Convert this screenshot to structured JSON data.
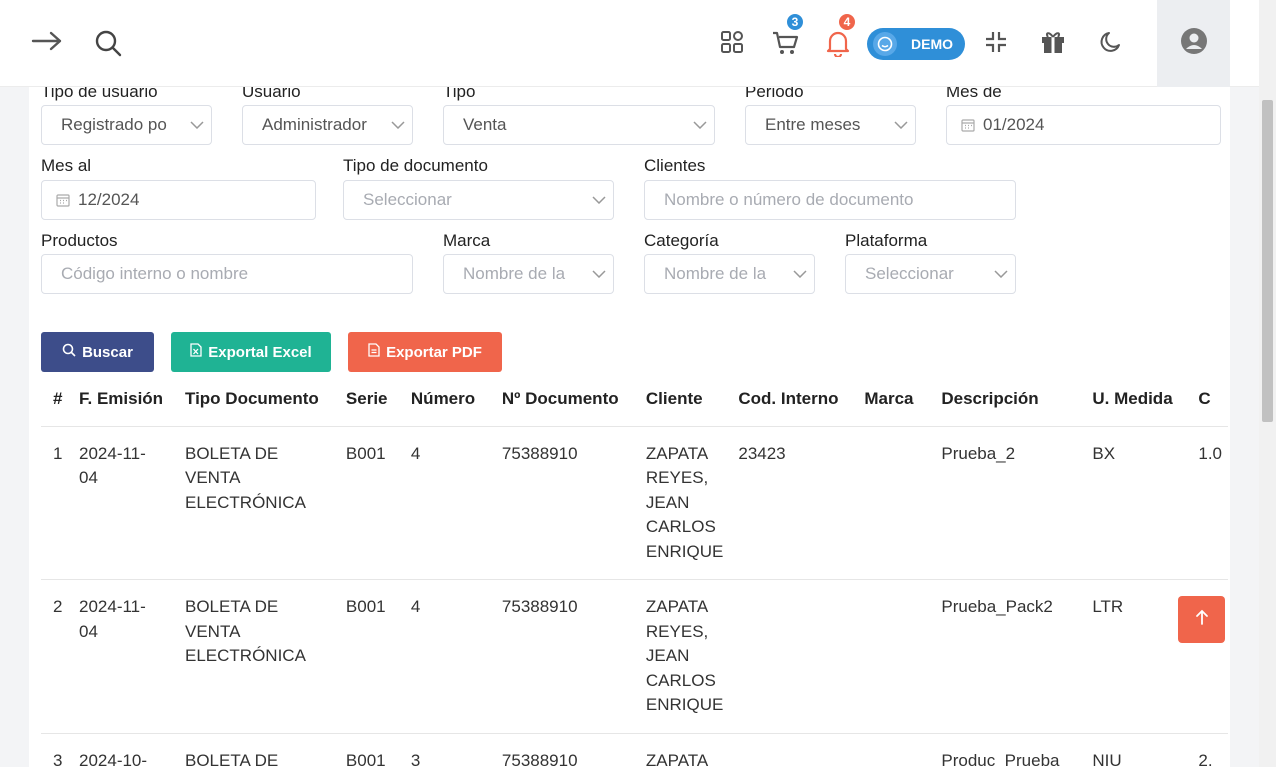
{
  "header": {
    "cart_badge": "3",
    "notif_badge": "4",
    "demo_label": "DEMO"
  },
  "filters": {
    "tipo_usuario": {
      "label": "Tipo de usuario",
      "value": "Registrado po"
    },
    "usuario": {
      "label": "Usuario",
      "value": "Administrador"
    },
    "tipo": {
      "label": "Tipo",
      "value": "Venta"
    },
    "periodo": {
      "label": "Periodo",
      "value": "Entre meses"
    },
    "mes_de": {
      "label": "Mes de",
      "value": "01/2024"
    },
    "mes_al": {
      "label": "Mes al",
      "value": "12/2024"
    },
    "tipo_documento": {
      "label": "Tipo de documento",
      "placeholder": "Seleccionar"
    },
    "clientes": {
      "label": "Clientes",
      "placeholder": "Nombre o número de documento"
    },
    "productos": {
      "label": "Productos",
      "placeholder": "Código interno o nombre"
    },
    "marca": {
      "label": "Marca",
      "placeholder": "Nombre de la"
    },
    "categoria": {
      "label": "Categoría",
      "placeholder": "Nombre de la"
    },
    "plataforma": {
      "label": "Plataforma",
      "placeholder": "Seleccionar"
    }
  },
  "actions": {
    "buscar": "Buscar",
    "excel": "Exportal Excel",
    "pdf": "Exportar PDF"
  },
  "table": {
    "columns": [
      "#",
      "F. Emisión",
      "Tipo Documento",
      "Serie",
      "Número",
      "Nº Documento",
      "Cliente",
      "Cod. Interno",
      "Marca",
      "Descripción",
      "U. Medida",
      "C"
    ],
    "rows": [
      [
        "1",
        "2024-11-04",
        "BOLETA DE VENTA ELECTRÓNICA",
        "B001",
        "4",
        "75388910",
        "ZAPATA REYES, JEAN CARLOS ENRIQUE",
        "23423",
        "",
        "Prueba_2",
        "BX",
        "1.0"
      ],
      [
        "2",
        "2024-11-04",
        "BOLETA DE VENTA ELECTRÓNICA",
        "B001",
        "4",
        "75388910",
        "ZAPATA REYES, JEAN CARLOS ENRIQUE",
        "",
        "",
        "Prueba_Pack2",
        "LTR",
        ""
      ],
      [
        "3",
        "2024-10-",
        "BOLETA DE",
        "B001",
        "3",
        "75388910",
        "ZAPATA",
        "",
        "",
        "Produc_Prueba",
        "NIU",
        "2."
      ]
    ]
  }
}
